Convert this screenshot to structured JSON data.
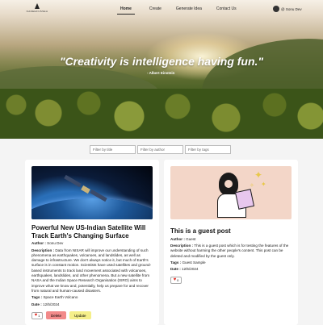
{
  "nav": {
    "logo_text": "NADEEFUSSEA",
    "links": [
      "Home",
      "Create",
      "Generate Idea",
      "Contact Us"
    ],
    "active": "Home",
    "user_name": "@ Sonu Dev"
  },
  "hero": {
    "quote": "\"Creativity is intelligence having fun.\"",
    "author": "- Albert Einstein"
  },
  "filters": {
    "title_placeholder": "Filter by title",
    "author_placeholder": "Filter by author",
    "tags_placeholder": "Filter by tags"
  },
  "posts": [
    {
      "title": "Powerful New US-Indian Satellite Will Track Earth's Changing Surface",
      "author_label": "Author :",
      "author": "Sonu Dev",
      "description_label": "Description :",
      "description": "Data from NISAR will improve our understanding of such phenomena as earthquakes, volcanoes, and landslides, as well as damage to infrastructure. We don't always notice it, but much of Earth's surface is in constant motion. Scientists have used satellites and ground-based instruments to track land movement associated with volcanoes, earthquakes, landslides, and other phenomena. But a new satellite from NASA and the Indian Space Research Organisation (ISRO) aims to improve what we know and, potentially, help us prepare for and recover from natural and human-caused disasters.",
      "tags_label": "Tags :",
      "tags": "Space Earth Volcano",
      "date_label": "Date :",
      "date": "12/5/2024",
      "likes": "1",
      "delete_label": "Delete",
      "update_label": "Update"
    },
    {
      "title": "This is a guest post",
      "author_label": "Author :",
      "author": "Guest",
      "description_label": "Description :",
      "description": "This is a guest post which is for testing the features of the website without harming the other people's content. This post can be deleted and modified by the guest only.",
      "tags_label": "Tags :",
      "tags": "Guest Sample",
      "date_label": "Date :",
      "date": "12/5/2024",
      "likes": "0"
    }
  ]
}
